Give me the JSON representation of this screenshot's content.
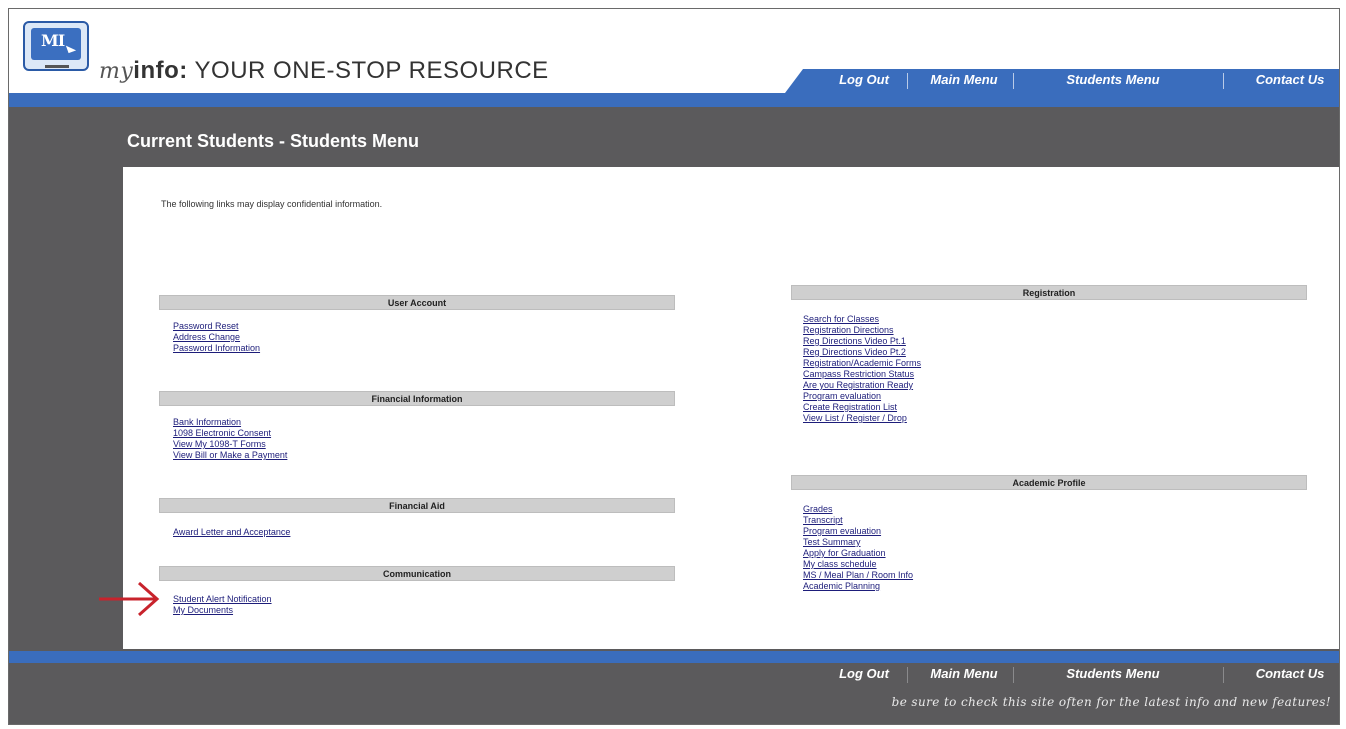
{
  "header": {
    "logo_text": "MI",
    "brand_my": "my",
    "brand_info": "info:",
    "brand_rest": " YOUR ONE-STOP RESOURCE"
  },
  "nav": {
    "items": [
      {
        "label": "Log Out"
      },
      {
        "label": "Main Menu"
      },
      {
        "label": "Students Menu"
      },
      {
        "label": "Contact Us"
      }
    ]
  },
  "page": {
    "title": "Current Students - Students Menu",
    "intro": "The following links may display confidential information."
  },
  "sections": {
    "user_account": {
      "title": "User Account",
      "links": [
        "Password Reset",
        "Address Change",
        "Password Information"
      ]
    },
    "financial_information": {
      "title": "Financial Information",
      "links": [
        "Bank Information",
        "1098 Electronic Consent",
        "View My 1098-T Forms",
        "View Bill or Make a Payment"
      ]
    },
    "financial_aid": {
      "title": "Financial Aid",
      "links": [
        "Award Letter and Acceptance"
      ]
    },
    "communication": {
      "title": "Communication",
      "links": [
        "Student Alert Notification",
        "My Documents"
      ]
    },
    "registration": {
      "title": "Registration",
      "links": [
        "Search for Classes",
        "Registration Directions",
        "Reg Directions Video Pt.1",
        "Reg Directions Video Pt.2",
        "Registration/Academic Forms",
        "Campass Restriction Status",
        "Are you Registration Ready",
        "Program evaluation",
        "Create Registration List",
        "View List / Register / Drop"
      ]
    },
    "academic_profile": {
      "title": "Academic Profile",
      "links": [
        "Grades",
        "Transcript",
        "Program evaluation",
        "Test Summary",
        "Apply for Graduation",
        "My class schedule",
        "MS / Meal Plan / Room Info",
        "Academic Planning"
      ]
    }
  },
  "footer": {
    "tagline": "be sure to check this site often for the latest info and new features!"
  },
  "colors": {
    "nav_blue": "#3a6dbd",
    "dark_gray": "#5b5a5c",
    "arrow_red": "#c8232c"
  }
}
